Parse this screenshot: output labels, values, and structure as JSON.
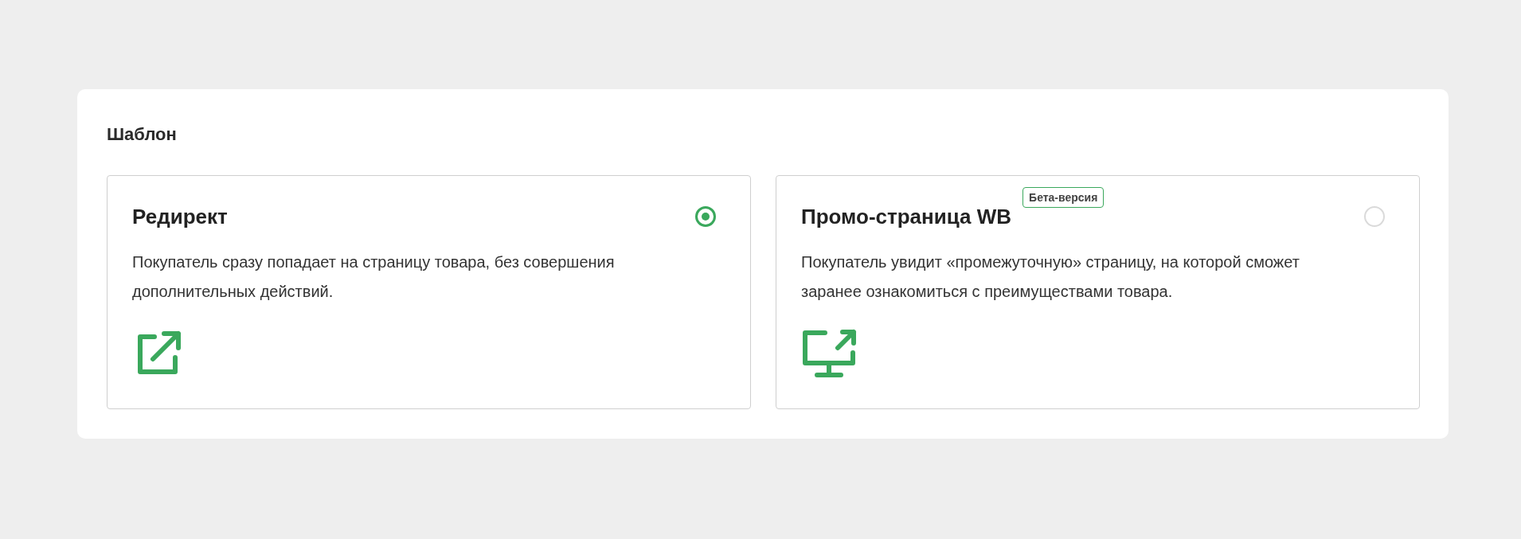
{
  "section": {
    "title": "Шаблон"
  },
  "options": [
    {
      "title": "Редирект",
      "selected": true,
      "kind": "external-link",
      "description": "Покупатель сразу попадает на страницу товара, без совершения дополнительных действий."
    },
    {
      "title": "Промо-страница WB",
      "selected": false,
      "badge": "Бета-версия",
      "kind": "monitor",
      "description": "Покупатель увидит «промежуточную» страницу, на которой сможет заранее ознакомиться с преимуществами товара."
    }
  ]
}
